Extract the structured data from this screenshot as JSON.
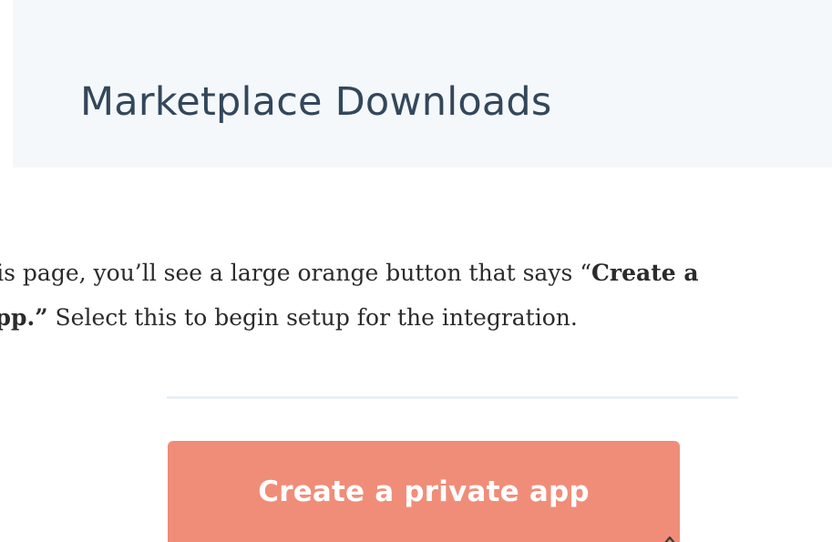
{
  "header": {
    "title": "Marketplace Downloads"
  },
  "instruction": {
    "line1_text": "this page, you’ll see a large orange button that says “",
    "line1_bold": "Create a",
    "line2_bold": "ate app.”",
    "line2_text": " Select this to begin setup for the integration."
  },
  "screenshot": {
    "button_label": "Create a private app"
  },
  "colors": {
    "header_background": "#f5f8fa",
    "header_text": "#33475b",
    "button_background": "#f08d79",
    "button_text": "#ffffff",
    "body_text": "#2b2b2b"
  },
  "icons": {
    "resize_indicator": "chevron-up-icon"
  }
}
